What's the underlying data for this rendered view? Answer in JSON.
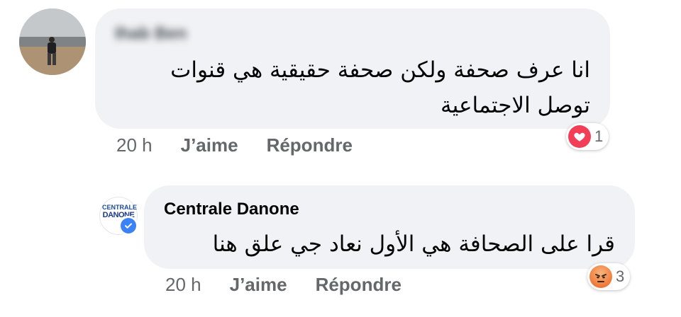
{
  "comments": [
    {
      "author": "Ihab Ben",
      "text_line1": "انا عرف صحفة ولكن صحفة حقيقية هي قنوات",
      "text_line2": "توصل الاجتماعية",
      "time": "20 h",
      "like_label": "J’aime",
      "reply_label": "Répondre",
      "reaction": {
        "icon": "heart-icon",
        "count": "1",
        "color": "#f33e58"
      }
    },
    {
      "author": "Centrale Danone",
      "avatar_logo_line1": "CENTRALE",
      "avatar_logo_line2": "DANONE",
      "text": "قرا على الصحافة هي الأول نعاد جي علق هنا",
      "time": "20 h",
      "like_label": "J’aime",
      "reply_label": "Répondre",
      "reaction": {
        "icon": "angry-face-icon",
        "count": "3",
        "color": "#f07a3a"
      }
    }
  ]
}
